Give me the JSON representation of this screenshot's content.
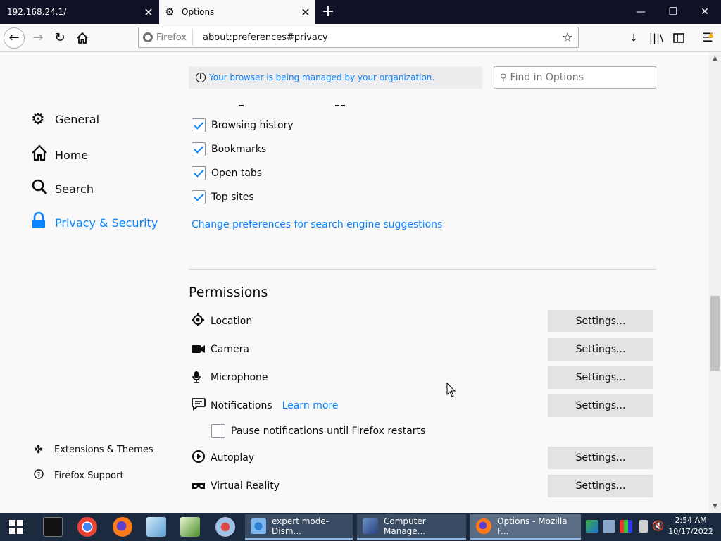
{
  "tabs": [
    {
      "title": "192.168.24.1/",
      "active": false
    },
    {
      "title": "Options",
      "active": true,
      "icon": "gear-icon"
    }
  ],
  "window_controls": {
    "minimize": "—",
    "maximize": "❐",
    "close": "✕"
  },
  "navbar": {
    "identity_label": "Firefox",
    "url": "about:preferences#privacy"
  },
  "sidebar": {
    "categories": [
      {
        "label": "General",
        "icon": "gear-icon"
      },
      {
        "label": "Home",
        "icon": "home-icon"
      },
      {
        "label": "Search",
        "icon": "search-icon"
      },
      {
        "label": "Privacy & Security",
        "icon": "lock-icon",
        "selected": true
      }
    ],
    "footer": [
      {
        "label": "Extensions & Themes",
        "icon": "puzzle-icon"
      },
      {
        "label": "Firefox Support",
        "icon": "help-icon"
      }
    ]
  },
  "managed_notice": "Your browser is being managed by your organization.",
  "find_placeholder": "Find in Options",
  "address_bar_options": [
    {
      "label": "Browsing history",
      "checked": true
    },
    {
      "label": "Bookmarks",
      "checked": true
    },
    {
      "label": "Open tabs",
      "checked": true
    },
    {
      "label": "Top sites",
      "checked": true
    }
  ],
  "search_suggestions_link": "Change preferences for search engine suggestions",
  "permissions": {
    "title": "Permissions",
    "settings_label": "Settings...",
    "rows": [
      {
        "label": "Location",
        "icon": "location-icon"
      },
      {
        "label": "Camera",
        "icon": "camera-icon"
      },
      {
        "label": "Microphone",
        "icon": "microphone-icon"
      },
      {
        "label": "Notifications",
        "icon": "notifications-icon",
        "learn_more": "Learn more"
      },
      {
        "label": "Autoplay",
        "icon": "autoplay-icon"
      },
      {
        "label": "Virtual Reality",
        "icon": "vr-icon"
      }
    ],
    "pause_notifications": {
      "label": "Pause notifications until Firefox restarts",
      "checked": false
    }
  },
  "taskbar": {
    "windows": [
      {
        "title": "expert mode-Dism...",
        "active": false
      },
      {
        "title": "Computer Manage...",
        "active": false
      },
      {
        "title": "Options - Mozilla F...",
        "active": true
      }
    ],
    "clock": {
      "time": "2:54 AM",
      "date": "10/17/2022"
    }
  },
  "colors": {
    "accent": "#0a84ff",
    "tabstrip": "#0f1126",
    "taskbar": "#1b2a3f"
  }
}
